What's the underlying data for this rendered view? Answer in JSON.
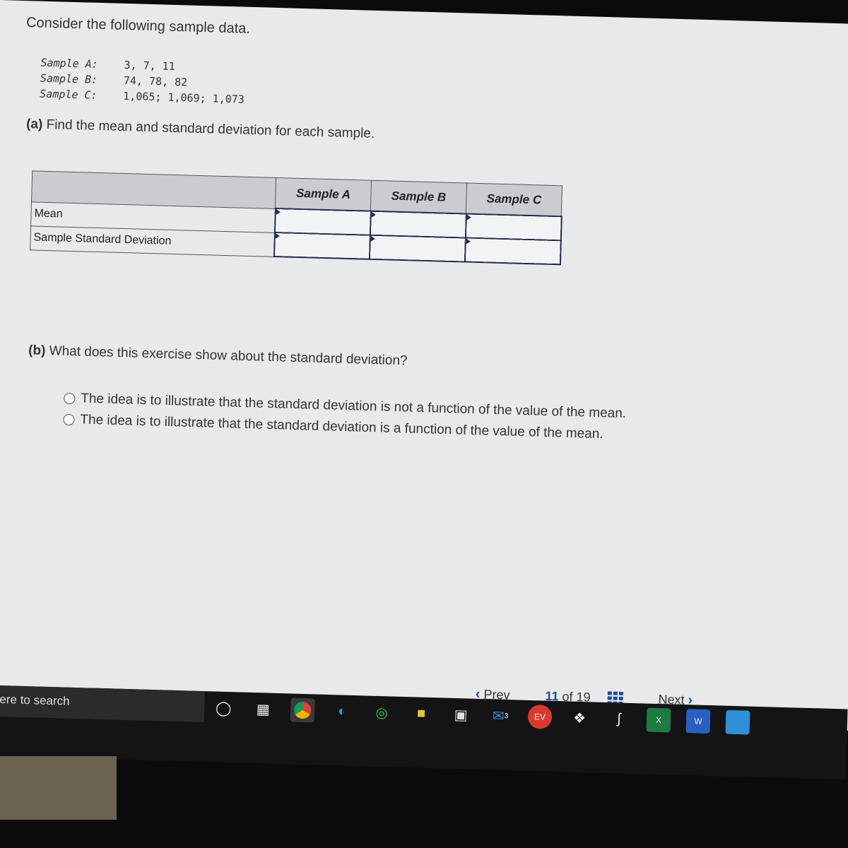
{
  "question": {
    "intro": "Consider the following sample data.",
    "samples": [
      {
        "label": "Sample A:",
        "values": "3, 7, 11"
      },
      {
        "label": "Sample B:",
        "values": "74, 78, 82"
      },
      {
        "label": "Sample C:",
        "values": "1,065; 1,069; 1,073"
      }
    ],
    "part_a_label": "(a)",
    "part_a_text": "Find the mean and standard deviation for each sample.",
    "table": {
      "columns": [
        "Sample A",
        "Sample B",
        "Sample C"
      ],
      "rows": [
        "Mean",
        "Sample Standard Deviation"
      ]
    },
    "part_b_label": "(b)",
    "part_b_text": "What does this exercise show about the standard deviation?",
    "options": [
      "The idea is to illustrate that the standard deviation is not a function of the value of the mean.",
      "The idea is to illustrate that the standard deviation is a function of the value of the mean."
    ]
  },
  "nav": {
    "prev": "Prev",
    "current": "11",
    "of": "of",
    "total": "19",
    "next": "Next"
  },
  "taskbar": {
    "search_text": "ere to search",
    "mail_badge": "3"
  },
  "colors": {
    "accent": "#1f4e9c",
    "header": "#c9ccd1"
  }
}
